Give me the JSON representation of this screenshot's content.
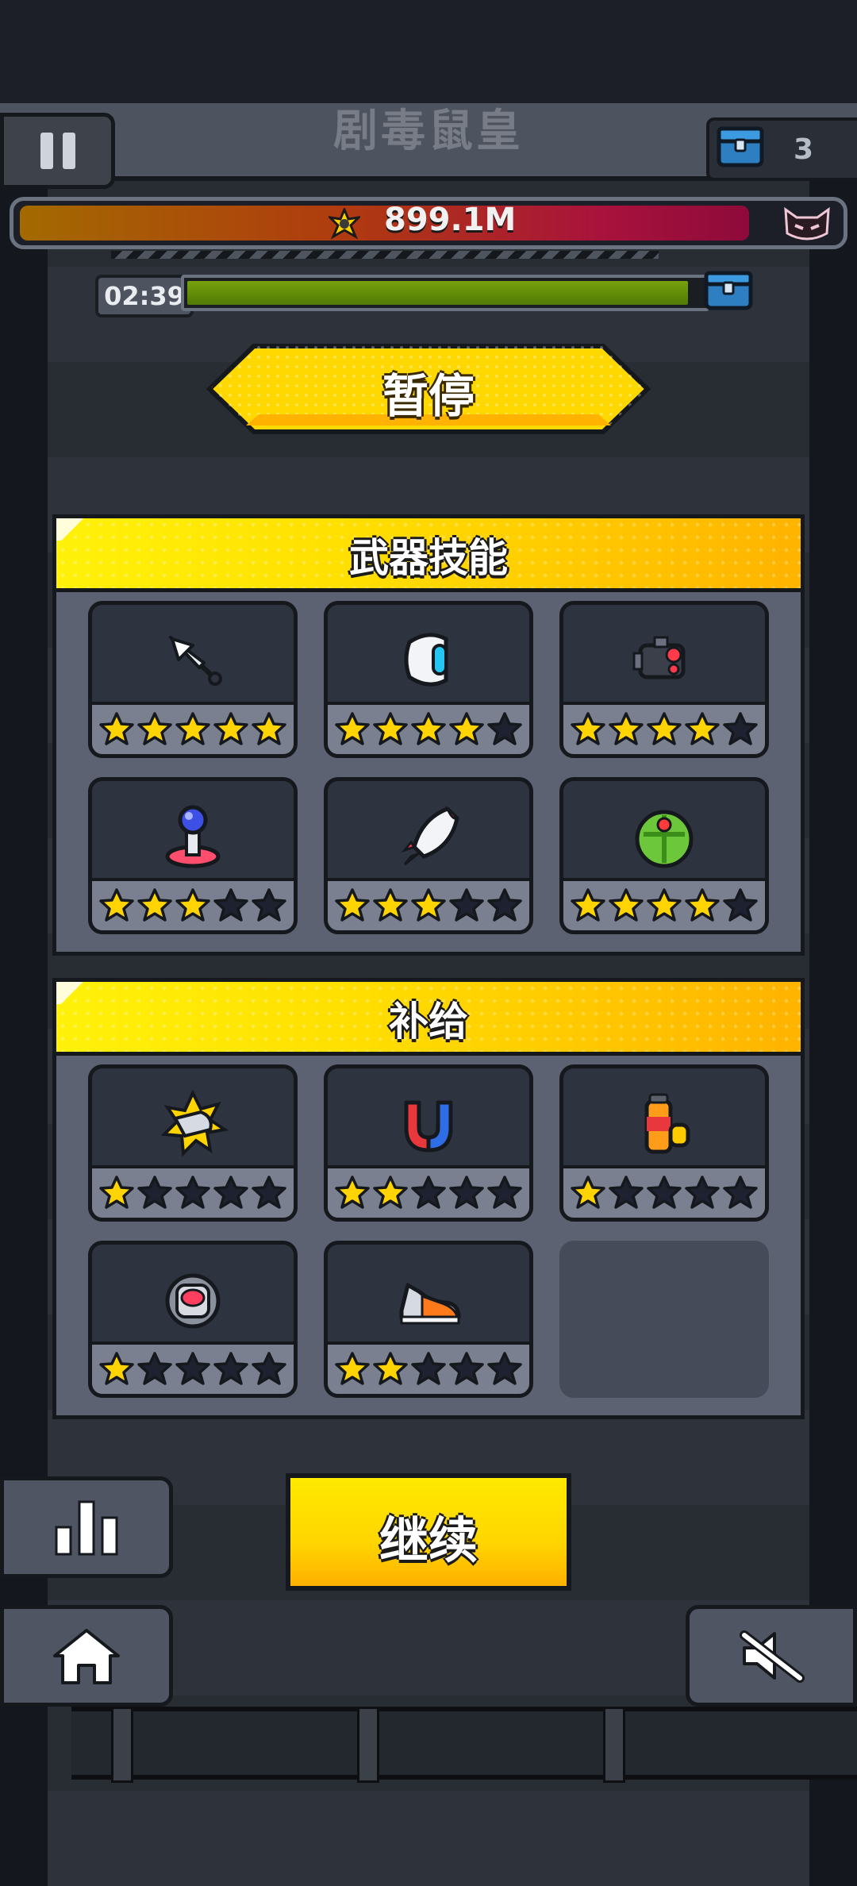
{
  "hud": {
    "boss_name": "剧毒鼠皇",
    "chest_count": "3",
    "boss_hp": "899.1M",
    "boss_hp_fraction": 0.95,
    "timer": "02:39",
    "wave_progress_fraction": 0.97
  },
  "pause": {
    "title": "暂停"
  },
  "weapons": {
    "title": "武器技能",
    "items": [
      {
        "icon": "kunai-icon",
        "stars": 5
      },
      {
        "icon": "guardian-drone-icon",
        "stars": 4
      },
      {
        "icon": "laser-bot-icon",
        "stars": 4
      },
      {
        "icon": "tesla-coil-icon",
        "stars": 3
      },
      {
        "icon": "rocket-icon",
        "stars": 3
      },
      {
        "icon": "soccer-ball-icon",
        "stars": 4
      }
    ]
  },
  "supplies": {
    "title": "补给",
    "items": [
      {
        "icon": "high-explosive-bullet-icon",
        "stars": 1
      },
      {
        "icon": "magnet-icon",
        "stars": 2
      },
      {
        "icon": "fuel-cell-icon",
        "stars": 1
      },
      {
        "icon": "energy-cube-icon",
        "stars": 1
      },
      {
        "icon": "sneaker-icon",
        "stars": 2
      }
    ],
    "empty_slots": 1
  },
  "buttons": {
    "continue_label": "继续"
  },
  "colors": {
    "panel_header": "#ffdf00",
    "star_filled": "#ffd400",
    "star_empty": "#1e2230",
    "boss_hp": "#a8123c",
    "wave_bar": "#6b9407"
  }
}
